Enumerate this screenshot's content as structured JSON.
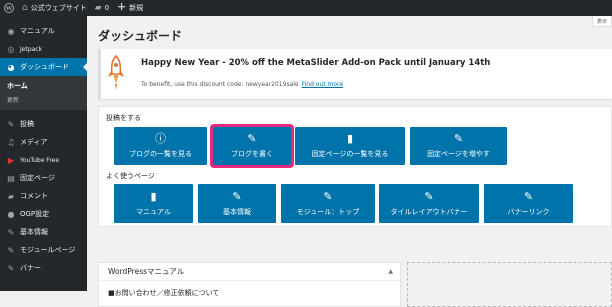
{
  "adminbar": {
    "wp_logo": "wordpress-logo",
    "site_icon": "home-icon",
    "site_name": "公式ウェブサイト",
    "comments_icon": "comment-bubble-icon",
    "comments_count": "0",
    "new_icon": "plus-icon",
    "new_label": "新規"
  },
  "screen_options_label": "表示",
  "sidebar": {
    "items_top": [
      {
        "icon": "gauge-icon",
        "label": "マニュアル"
      },
      {
        "icon": "jetpack-icon",
        "label": "Jetpack"
      },
      {
        "icon": "dashboard-icon",
        "label": "ダッシュボード",
        "current": true
      }
    ],
    "submenu": [
      {
        "label": "ホーム",
        "active": true
      },
      {
        "label": "更新",
        "active": false
      }
    ],
    "items_bottom": [
      {
        "icon": "pin-icon",
        "label": "投稿"
      },
      {
        "icon": "media-icon",
        "label": "メディア"
      },
      {
        "icon": "youtube-icon",
        "label": "YouTube Free"
      },
      {
        "icon": "page-icon",
        "label": "固定ページ"
      },
      {
        "icon": "comment-icon",
        "label": "コメント"
      },
      {
        "icon": "ogp-icon",
        "label": "OGP設定"
      },
      {
        "icon": "pin-icon",
        "label": "基本情報"
      },
      {
        "icon": "pin-icon",
        "label": "モジュールページ"
      },
      {
        "icon": "pin-icon",
        "label": "バナー"
      }
    ]
  },
  "page_title": "ダッシュボード",
  "notice": {
    "title": "Happy New Year - 20% off the MetaSlider Add-on Pack until January 14th",
    "desc": "To benefit, use this discount code: newyear2019sale",
    "link": "Find out more"
  },
  "quick": {
    "section1_label": "投稿をする",
    "section1_buttons": [
      {
        "icon": "info-icon",
        "label": "ブログの一覧を見る"
      },
      {
        "icon": "edit-icon",
        "label": "ブログを書く",
        "highlight": true
      },
      {
        "icon": "book-icon",
        "label": "固定ページの一覧を見る"
      },
      {
        "icon": "edit-icon",
        "label": "固定ページを増やす"
      }
    ],
    "section2_label": "よく使うページ",
    "section2_buttons": [
      {
        "icon": "document-icon",
        "label": "マニュアル"
      },
      {
        "icon": "edit-icon",
        "label": "基本情報"
      },
      {
        "icon": "edit-icon",
        "label": "モジュール：トップ"
      },
      {
        "icon": "edit-icon",
        "label": "タイルレイアウトバナー"
      },
      {
        "icon": "edit-icon",
        "label": "バナーリンク"
      }
    ]
  },
  "manual_box": {
    "title": "WordPressマニュアル",
    "item": "■お問い合わせ／修正依頼について"
  },
  "colors": {
    "admin_dark": "#23282d",
    "accent_blue": "#0073aa",
    "highlight_pink": "#e6297e"
  }
}
